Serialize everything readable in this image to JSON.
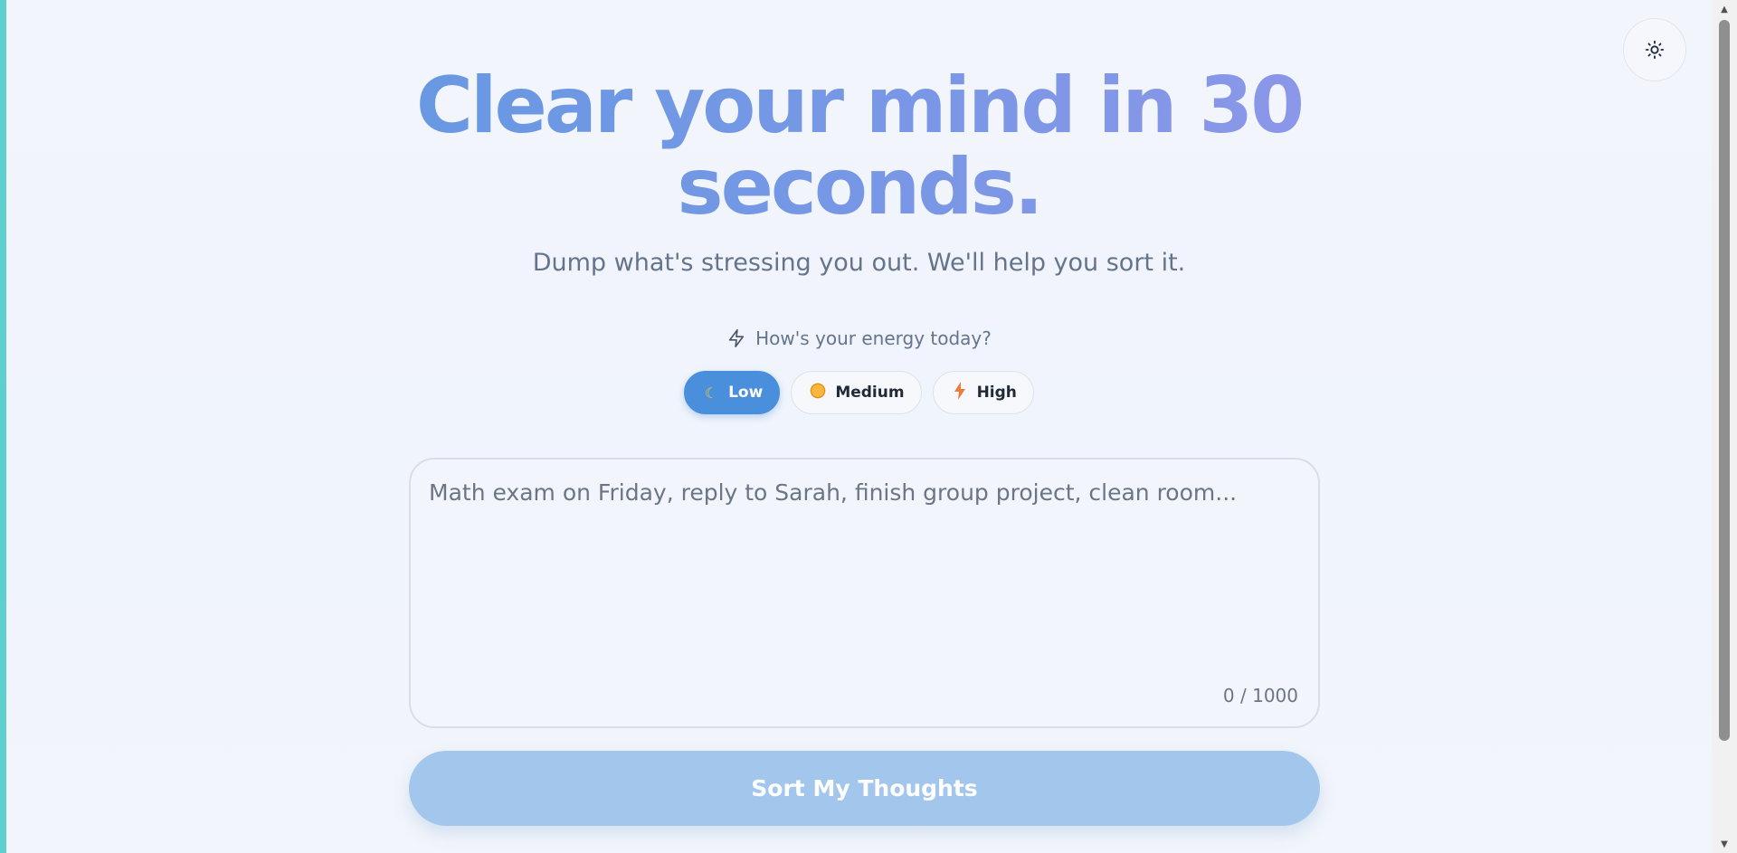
{
  "hero": {
    "title_line1": "Clear your mind in 30",
    "title_line2": "seconds.",
    "subtitle": "Dump what's stressing you out. We'll help you sort it."
  },
  "theme_toggle": {
    "icon": "sun-icon"
  },
  "energy": {
    "question": "How's your energy today?",
    "question_icon": "lightning-icon",
    "options": [
      {
        "label": "Low",
        "icon": "moon-icon",
        "selected": true
      },
      {
        "label": "Medium",
        "icon": "sun-emoji-icon",
        "selected": false
      },
      {
        "label": "High",
        "icon": "lightning-bolt-icon",
        "selected": false
      }
    ]
  },
  "input": {
    "placeholder": "Math exam on Friday, reply to Sarah, finish group project, clean room...",
    "value": "",
    "char_count": "0 / 1000"
  },
  "submit": {
    "label": "Sort My Thoughts"
  },
  "colors": {
    "accent": "#4a8fdb",
    "submit_disabled": "#a3c7ec",
    "title_gradient_start": "#5b9ae0",
    "title_gradient_end": "#9f97ea",
    "left_edge": "#5ecfcf"
  }
}
